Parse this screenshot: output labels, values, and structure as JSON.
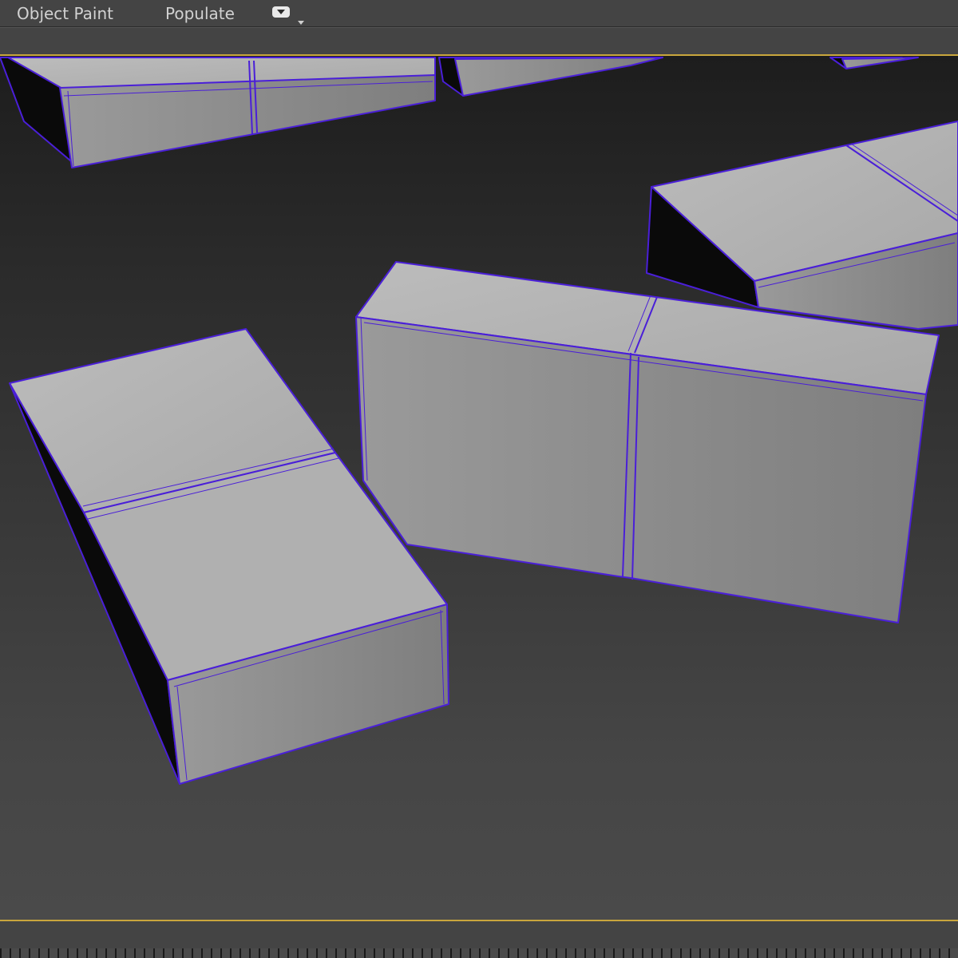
{
  "menubar": {
    "items": [
      {
        "label": "Object Paint"
      },
      {
        "label": "Populate"
      }
    ],
    "extras_icon": "speech-bubble-icon"
  },
  "viewport": {
    "colors": {
      "wire": "#4a1fd8",
      "top_face": "#b3b3b3",
      "front_face": "#8c8c8c",
      "shadow_face": "#0a0a0a",
      "frame_border": "#c9a63d"
    }
  }
}
